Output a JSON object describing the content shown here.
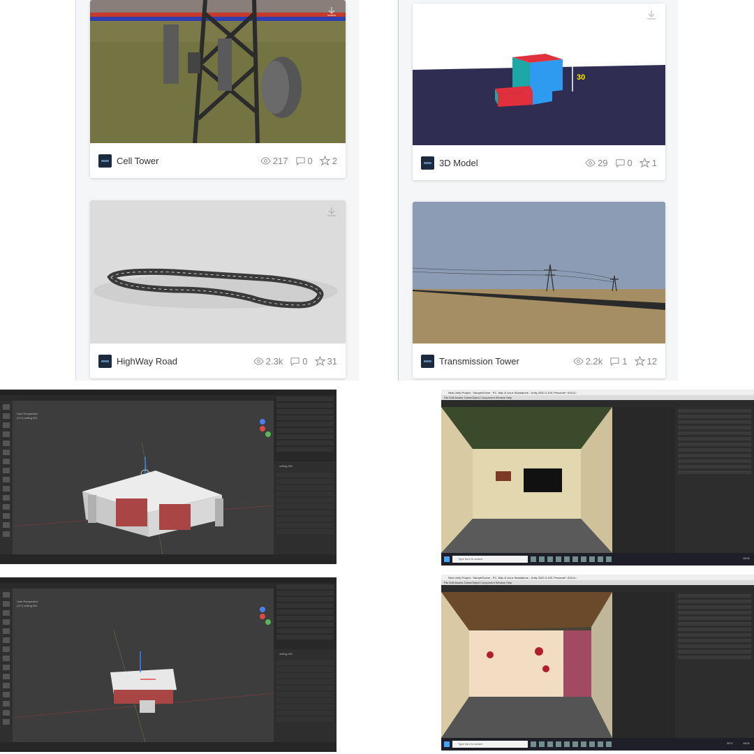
{
  "cards": [
    {
      "title": "Cell Tower",
      "views": "217",
      "comments": "0",
      "stars": "2"
    },
    {
      "title": "3D Model",
      "views": "29",
      "comments": "0",
      "stars": "1",
      "annotation": "30"
    },
    {
      "title": "HighWay Road",
      "views": "2.3k",
      "comments": "0",
      "stars": "31"
    },
    {
      "title": "Transmission Tower",
      "views": "2.2k",
      "comments": "1",
      "stars": "12"
    }
  ],
  "blender": {
    "top": {
      "view_label": "User Perspective",
      "object": "(217) ceiling.001",
      "panel_object": "ceiling.001"
    },
    "bottom": {
      "view_label": "User Perspective",
      "object": "(217) ceiling.001",
      "panel_object": "ceiling.001"
    }
  },
  "unity": {
    "window_title": "New Unity Project - SampleScene - PC, Mac & Linux Standalone - Unity 2020.3.12f1 Personal* <DX11>",
    "menu": "File  Edit  Assets  GameObject  Component  Window  Help",
    "search_placeholder": "Type here to search",
    "temperature": "34°C",
    "time": "15:01"
  },
  "colors": {
    "accent": "#1c2a3d",
    "unity_dark": "#2b2b2b",
    "blender_bg": "#3d3d3d"
  }
}
